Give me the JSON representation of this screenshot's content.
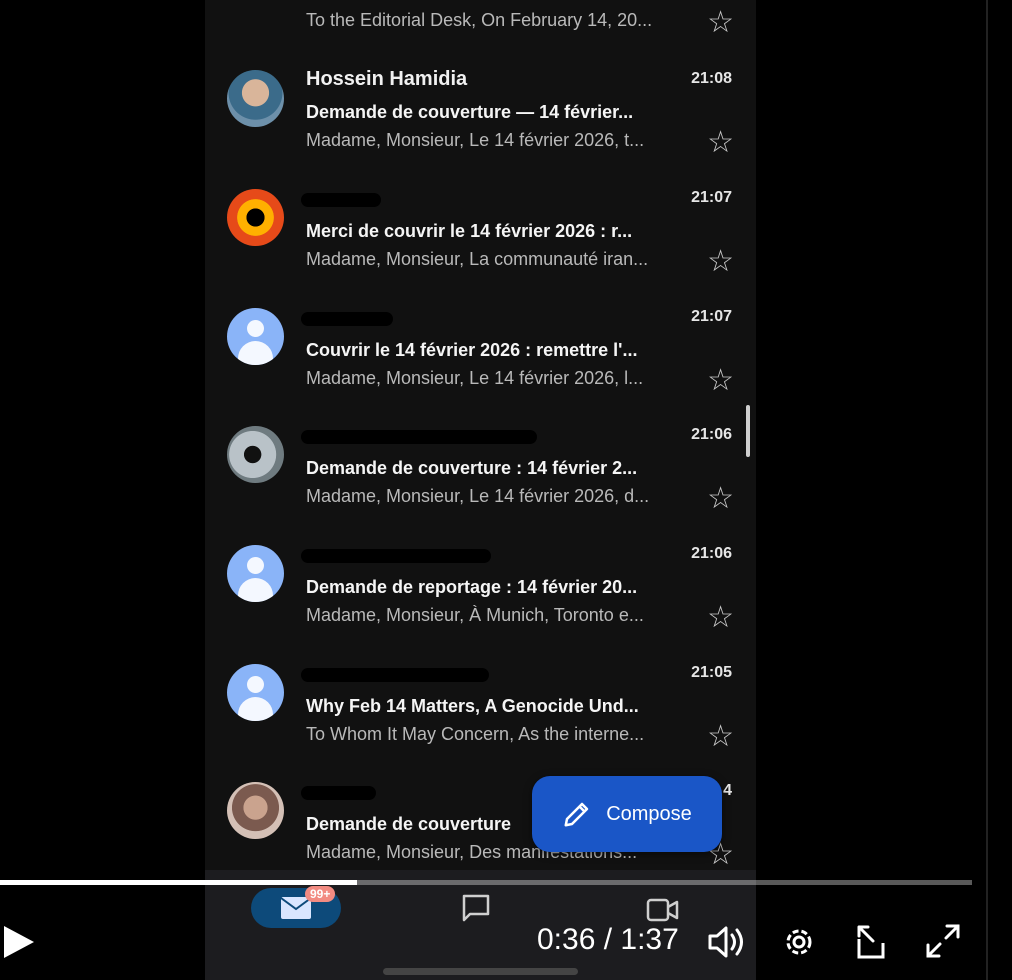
{
  "inbox": {
    "emails": [
      {
        "sender": "",
        "time": "",
        "subject": "",
        "snippet": "To the Editorial Desk, On February 14, 20...",
        "avatar": "hidden"
      },
      {
        "sender": "Hossein Hamidia",
        "time": "21:08",
        "subject": "Demande de couverture — 14 février...",
        "snippet": "Madame, Monsieur, Le 14 février 2026, t...",
        "avatar": "photo1"
      },
      {
        "sender": "",
        "time": "21:07",
        "subject": "Merci de couvrir le 14 février 2026 : r...",
        "snippet": "Madame, Monsieur, La communauté iran...",
        "avatar": "photo2"
      },
      {
        "sender": "",
        "time": "21:07",
        "subject": "Couvrir le 14 février 2026 : remettre l'...",
        "snippet": "Madame, Monsieur, Le 14 février 2026, l...",
        "avatar": "default"
      },
      {
        "sender": "",
        "time": "21:06",
        "subject": "Demande de couverture : 14 février 2...",
        "snippet": "Madame, Monsieur, Le 14 février 2026, d...",
        "avatar": "photo3"
      },
      {
        "sender": "",
        "time": "21:06",
        "subject": "Demande de reportage : 14 février 20...",
        "snippet": "Madame, Monsieur, À Munich, Toronto e...",
        "avatar": "default"
      },
      {
        "sender": "",
        "time": "21:05",
        "subject": "Why Feb 14 Matters, A Genocide Und...",
        "snippet": "To Whom It May Concern, As the interne...",
        "avatar": "default"
      },
      {
        "sender": "",
        "time": "4",
        "subject": "Demande de couverture",
        "snippet": "Madame, Monsieur, Des manifestations...",
        "avatar": "photo4"
      }
    ]
  },
  "compose": {
    "label": "Compose",
    "icon": "pencil-icon"
  },
  "bottom_nav": {
    "mail_badge": "99+",
    "items": [
      "mail-icon",
      "chat-icon",
      "video-icon"
    ]
  },
  "video": {
    "current_time": "0:36",
    "separator": " / ",
    "duration": "1:37",
    "progress": 0.367
  }
}
